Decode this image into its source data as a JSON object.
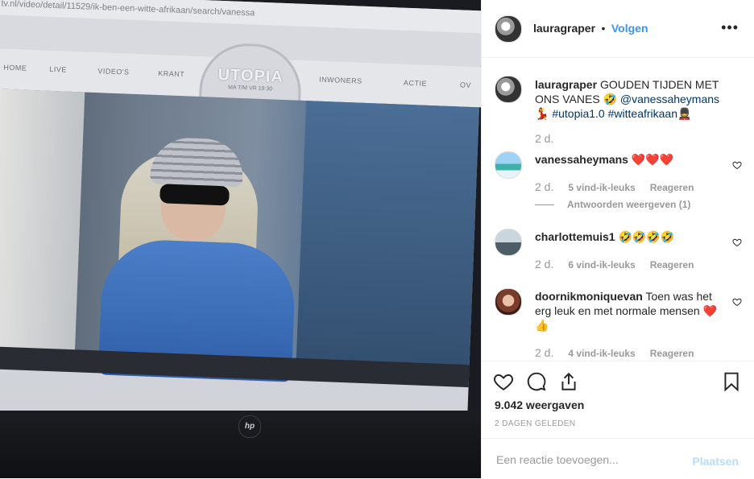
{
  "media": {
    "url_text": "tv.nl/video/detail/11529/ik-ben-een-witte-afrikaan/search/vanessa",
    "nav": [
      "HOME",
      "LIVE",
      "VIDEO'S",
      "KRANT",
      "INWONERS",
      "ACTIE",
      "OV"
    ],
    "logo_text": "UTOPIA",
    "logo_sub": "MA T/M VR 19:30",
    "brand": "hp"
  },
  "header": {
    "username": "lauragraper",
    "separator": "•",
    "follow_label": "Volgen",
    "more_icon": "ellipsis-icon"
  },
  "caption": {
    "username": "lauragraper",
    "text": "GOUDEN TIJDEN MET ONS VANES 🤣",
    "mention": "@vanessaheymans",
    "emoji1": "💃",
    "tag1": "#utopia1.0",
    "tag2": "#witteafrikaan",
    "emoji2": "💂",
    "time": "2 d."
  },
  "comments": [
    {
      "username": "vanessaheymans",
      "text": "❤️❤️❤️",
      "time": "2 d.",
      "likes": "5 vind-ik-leuks",
      "reply": "Reageren",
      "view_replies": "Antwoorden weergeven (1)"
    },
    {
      "username": "charlottemuis1",
      "text": "🤣🤣🤣🤣",
      "time": "2 d.",
      "likes": "6 vind-ik-leuks",
      "reply": "Reageren"
    },
    {
      "username": "doornikmoniquevan",
      "text": "Toen was het erg leuk en met normale mensen ❤️👍",
      "time": "2 d.",
      "likes": "4 vind-ik-leuks",
      "reply": "Reageren"
    }
  ],
  "actions": {
    "views": "9.042 weergaven",
    "date": "2 DAGEN GELEDEN"
  },
  "composer": {
    "placeholder": "Een reactie toevoegen...",
    "post_label": "Plaatsen"
  },
  "colors": {
    "accent": "#3897f0",
    "text": "#262626",
    "muted": "#999999",
    "tag": "#003569",
    "post_disabled": "#b2dffc"
  }
}
